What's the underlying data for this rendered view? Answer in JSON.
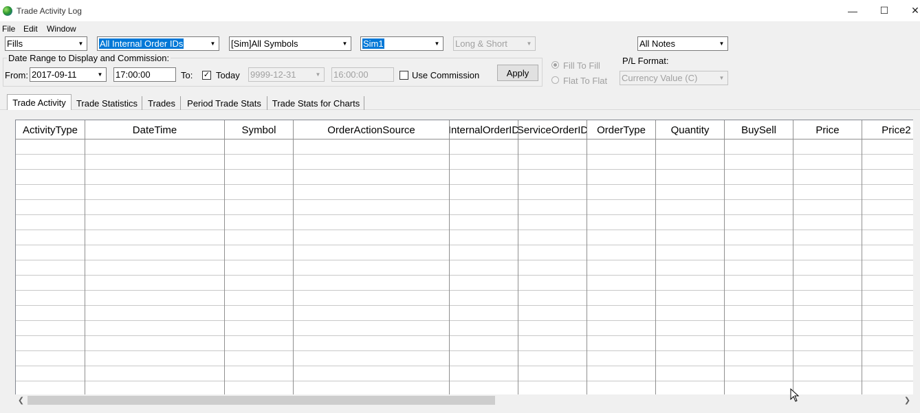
{
  "window": {
    "title": "Trade Activity Log",
    "minimize": "—",
    "maximize": "☐",
    "close": "✕"
  },
  "menu": [
    "File",
    "Edit",
    "Window"
  ],
  "filters": {
    "type": "Fills",
    "order_ids": "All Internal Order IDs",
    "symbols": "[Sim]All Symbols",
    "account": "Sim1",
    "direction": "Long & Short",
    "notes": "All Notes"
  },
  "date_range": {
    "group_label": "Date Range to Display and Commission:",
    "from_label": "From:",
    "from_date": "2017-09-11",
    "from_time": "17:00:00",
    "to_label": "To:",
    "today_label": "Today",
    "today_checked": true,
    "to_date": "9999-12-31",
    "to_time": "16:00:00",
    "use_commission_label": "Use Commission",
    "use_commission_checked": false,
    "apply_label": "Apply"
  },
  "pl_options": {
    "fill_to_fill": "Fill To Fill",
    "flat_to_flat": "Flat To Flat",
    "format_label": "P/L Format:",
    "format_value": "Currency Value (C)"
  },
  "tabs": [
    "Trade Activity",
    "Trade Statistics",
    "Trades",
    "Period Trade Stats",
    "Trade Stats for Charts"
  ],
  "active_tab": "Trade Activity",
  "table": {
    "columns": [
      "ActivityType",
      "DateTime",
      "Symbol",
      "OrderActionSource",
      "InternalOrderID",
      "ServiceOrderID",
      "OrderType",
      "Quantity",
      "BuySell",
      "Price",
      "Price2"
    ],
    "rows": []
  },
  "icons": {
    "dropdown": "chevron-down-icon",
    "scroll_left": "arrow-left-icon",
    "scroll_right": "arrow-right-icon",
    "app": "globe-icon"
  }
}
